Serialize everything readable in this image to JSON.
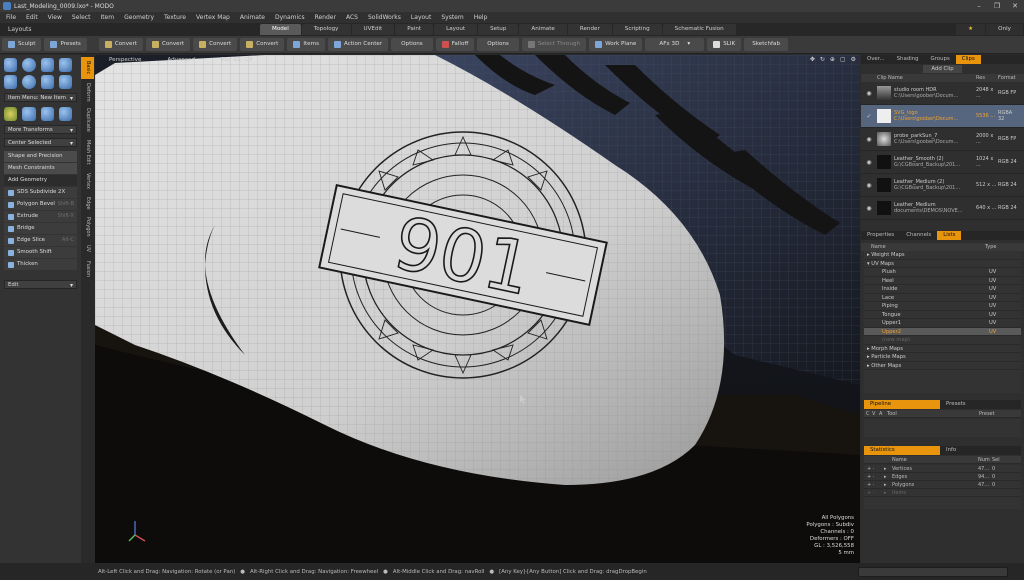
{
  "window": {
    "title": "Last_Modeling_0009.lxo* - MODO",
    "controls": [
      "–",
      "❐",
      "✕"
    ]
  },
  "menu": [
    "File",
    "Edit",
    "View",
    "Select",
    "Item",
    "Geometry",
    "Texture",
    "Vertex Map",
    "Animate",
    "Dynamics",
    "Render",
    "ACS",
    "SolidWorks",
    "Layout",
    "System",
    "Help"
  ],
  "layoutbar": {
    "label": "Layouts",
    "tabs": [
      "Model",
      "Topology",
      "UVEdit",
      "Paint",
      "Layout",
      "Setup",
      "Animate",
      "Render",
      "Scripting",
      "Schematic Fusion"
    ],
    "active": "Model",
    "right": [
      "★",
      "Only"
    ]
  },
  "toolbar": {
    "items": [
      "Sculpt",
      "Presets",
      "Convert",
      "Convert",
      "Convert",
      "Convert",
      "Items",
      "Action Center",
      "Options",
      "Falloff",
      "Options",
      "Select Through",
      "Work Plane",
      "AFx 3D",
      "SLIK",
      "Sketchfab"
    ]
  },
  "left": {
    "dropdowns": [
      "Item Menu: New Item",
      "More Transforms",
      "Center Selected",
      "Edit"
    ],
    "groups": [
      "Shape and Precision",
      "Mesh Constraints",
      "Add Geometry"
    ],
    "tools": [
      {
        "label": "SDS Subdivide 2X",
        "shortcut": ""
      },
      {
        "label": "Polygon Bevel",
        "shortcut": "Shift-B"
      },
      {
        "label": "Extrude",
        "shortcut": "Shift-X"
      },
      {
        "label": "Bridge",
        "shortcut": ""
      },
      {
        "label": "Edge Slice",
        "shortcut": "Alt-C"
      },
      {
        "label": "Smooth Shift",
        "shortcut": ""
      },
      {
        "label": "Thicken",
        "shortcut": ""
      }
    ],
    "sidetabs": [
      "Basic",
      "Deform",
      "Duplicate",
      "Mesh Edit",
      "Vertex",
      "Edge",
      "Polygon",
      "UV",
      "Fusion"
    ]
  },
  "viewport": {
    "header": [
      "Perspective",
      "Advanced",
      "Ray GL: Off"
    ],
    "controls": [
      "✥",
      "↻",
      "⊕",
      "▢",
      "⚙"
    ],
    "logo": {
      "text": "901"
    },
    "info": [
      "All Polygons",
      "Polygons : Subdiv",
      "Channels : 0",
      "Deformers : OFF",
      "GL : 3,526,558",
      "5 mm"
    ]
  },
  "right": {
    "tabs1": [
      "Over...",
      "Shading",
      "Groups",
      "Clips"
    ],
    "active1": "Clips",
    "add_clip": "Add Clip",
    "clip_headers": [
      "Clip Name",
      "Res",
      "Format"
    ],
    "clips": [
      {
        "name": "studio room HDR",
        "path": "C:\\Users\\goober\\Docum...",
        "res": "2048 x ...",
        "fmt": "RGB FP",
        "sel": false
      },
      {
        "name": "SVG_logo",
        "path": "C:\\Users\\goober\\Docum...",
        "res": "5536 ...",
        "fmt": "RGBA 32",
        "sel": true
      },
      {
        "name": "probe_parkSun_7",
        "path": "C:\\Users\\goober\\Docum...",
        "res": "2000 x ...",
        "fmt": "RGB FP",
        "sel": false
      },
      {
        "name": "Leather_Smooth (2)",
        "path": "G:\\CGBoard_Backup\\201...",
        "res": "1024 x ...",
        "fmt": "RGB 24",
        "sel": false
      },
      {
        "name": "Leather_Medium (2)",
        "path": "G:\\CGBoard_Backup\\201...",
        "res": "512 x ...",
        "fmt": "RGB 24",
        "sel": false
      },
      {
        "name": "Leather_Medium",
        "path": "documents\\DEMOS\\NOVE...",
        "res": "640 x ...",
        "fmt": "RGB 24",
        "sel": false
      }
    ],
    "tabs2": [
      "Properties",
      "Channels",
      "Lists"
    ],
    "active2": "Lists",
    "list_headers": [
      "Name",
      "Type"
    ],
    "tree": [
      {
        "label": "Weight Maps",
        "type": "",
        "indent": 0,
        "arrow": "▸",
        "sel": false,
        "dim": false
      },
      {
        "label": "UV Maps",
        "type": "",
        "indent": 0,
        "arrow": "▾",
        "sel": false,
        "dim": false
      },
      {
        "label": "Plush",
        "type": "UV",
        "indent": 1,
        "arrow": "",
        "sel": false,
        "dim": false
      },
      {
        "label": "Heel",
        "type": "UV",
        "indent": 1,
        "arrow": "",
        "sel": false,
        "dim": false
      },
      {
        "label": "Inside",
        "type": "UV",
        "indent": 1,
        "arrow": "",
        "sel": false,
        "dim": false
      },
      {
        "label": "Lace",
        "type": "UV",
        "indent": 1,
        "arrow": "",
        "sel": false,
        "dim": false
      },
      {
        "label": "Piping",
        "type": "UV",
        "indent": 1,
        "arrow": "",
        "sel": false,
        "dim": false
      },
      {
        "label": "Tongue",
        "type": "UV",
        "indent": 1,
        "arrow": "",
        "sel": false,
        "dim": false
      },
      {
        "label": "Upper1",
        "type": "UV",
        "indent": 1,
        "arrow": "",
        "sel": false,
        "dim": false
      },
      {
        "label": "Upper2",
        "type": "UV",
        "indent": 1,
        "arrow": "",
        "sel": true,
        "dim": false
      },
      {
        "label": "(new map)",
        "type": "",
        "indent": 1,
        "arrow": "",
        "sel": false,
        "dim": true
      },
      {
        "label": "Morph Maps",
        "type": "",
        "indent": 0,
        "arrow": "▸",
        "sel": false,
        "dim": false
      },
      {
        "label": "Particle Maps",
        "type": "",
        "indent": 0,
        "arrow": "▸",
        "sel": false,
        "dim": false
      },
      {
        "label": "Other Maps",
        "type": "",
        "indent": 0,
        "arrow": "▸",
        "sel": false,
        "dim": false
      }
    ],
    "tabs3": [
      "Pipeline",
      "Presets"
    ],
    "active3": "Pipeline",
    "pipe_headers": [
      "C",
      "V",
      "A",
      "Tool",
      "Preset"
    ],
    "tabs4": [
      "Statistics",
      "Info"
    ],
    "active4": "Statistics",
    "stat_headers": [
      "Name",
      "Num",
      "Sel"
    ],
    "stats": [
      {
        "label": "Vertices",
        "num": "47...",
        "sel": "0"
      },
      {
        "label": "Edges",
        "num": "94...",
        "sel": "0"
      },
      {
        "label": "Polygons",
        "num": "47...",
        "sel": "0"
      },
      {
        "label": "Items",
        "num": "",
        "sel": ""
      }
    ]
  },
  "status": [
    "Alt-Left Click and Drag: Navigation: Rotate (or Pan)",
    "Alt-Right Click and Drag: Navigation: Freewheel",
    "Alt-Middle Click and Drag: navRoll",
    "[Any Key]-[Any Button] Click and Drag: dragDropBegin"
  ]
}
